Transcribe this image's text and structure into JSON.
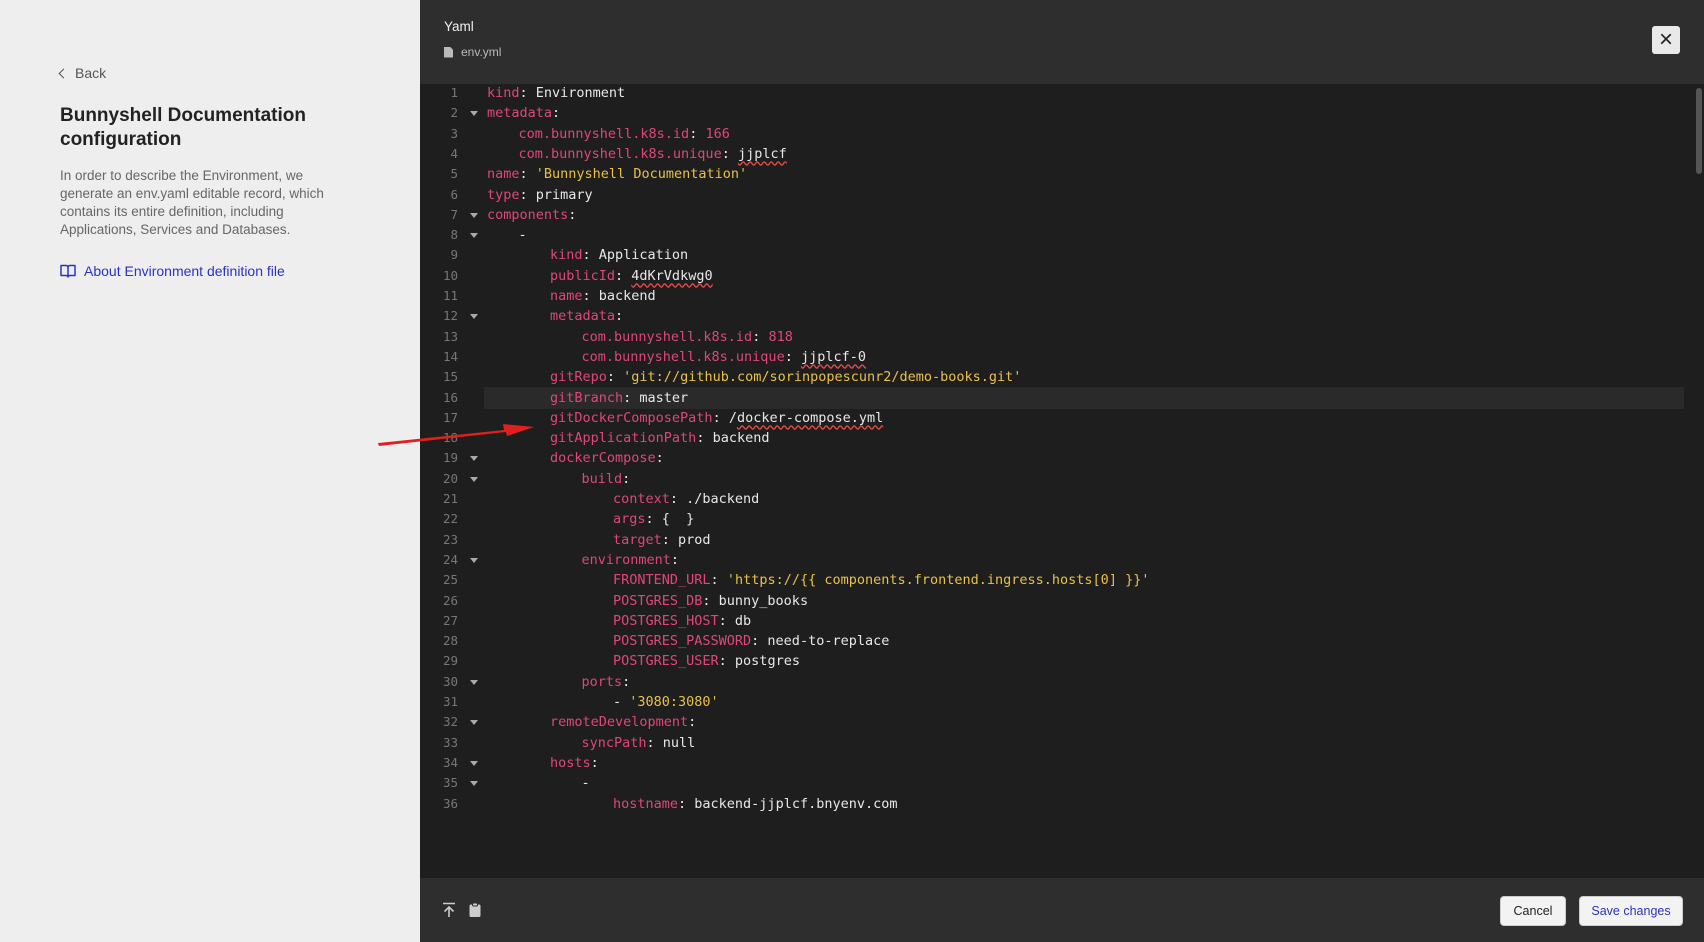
{
  "sidebar": {
    "back_label": "Back",
    "title": "Bunnyshell Documentation configuration",
    "description": "In order to describe the Environment, we generate an env.yaml editable record, which contains its entire definition, including Applications, Services and Databases.",
    "about_link": "About Environment definition file"
  },
  "modal": {
    "title": "Yaml",
    "filename": "env.yml",
    "close_icon": "close-icon"
  },
  "editor": {
    "active_line": 16,
    "lines": [
      {
        "n": "1",
        "indent": 0,
        "fold": false,
        "segs": [
          {
            "t": "kind",
            "c": "k"
          },
          {
            "t": ": Environment",
            "c": "p"
          }
        ]
      },
      {
        "n": "2",
        "indent": 0,
        "fold": true,
        "segs": [
          {
            "t": "metadata",
            "c": "k"
          },
          {
            "t": ":",
            "c": "p"
          }
        ]
      },
      {
        "n": "3",
        "indent": 1,
        "fold": false,
        "segs": [
          {
            "t": "com.bunnyshell.k8s.id",
            "c": "k"
          },
          {
            "t": ": ",
            "c": "p"
          },
          {
            "t": "166",
            "c": "n"
          }
        ]
      },
      {
        "n": "4",
        "indent": 1,
        "fold": false,
        "segs": [
          {
            "t": "com.bunnyshell.k8s.unique",
            "c": "k"
          },
          {
            "t": ": ",
            "c": "p"
          },
          {
            "t": "jjplcf",
            "c": "p",
            "sq": true
          }
        ]
      },
      {
        "n": "5",
        "indent": 0,
        "fold": false,
        "segs": [
          {
            "t": "name",
            "c": "k"
          },
          {
            "t": ": ",
            "c": "p"
          },
          {
            "t": "'Bunnyshell Documentation'",
            "c": "s"
          }
        ]
      },
      {
        "n": "6",
        "indent": 0,
        "fold": false,
        "segs": [
          {
            "t": "type",
            "c": "k"
          },
          {
            "t": ": primary",
            "c": "p"
          }
        ]
      },
      {
        "n": "7",
        "indent": 0,
        "fold": true,
        "segs": [
          {
            "t": "components",
            "c": "k"
          },
          {
            "t": ":",
            "c": "p"
          }
        ]
      },
      {
        "n": "8",
        "indent": 1,
        "fold": true,
        "segs": [
          {
            "t": "-",
            "c": "p"
          }
        ]
      },
      {
        "n": "9",
        "indent": 2,
        "fold": false,
        "segs": [
          {
            "t": "kind",
            "c": "k"
          },
          {
            "t": ": Application",
            "c": "p"
          }
        ]
      },
      {
        "n": "10",
        "indent": 2,
        "fold": false,
        "segs": [
          {
            "t": "publicId",
            "c": "k"
          },
          {
            "t": ": ",
            "c": "p"
          },
          {
            "t": "4dKrVdkwg0",
            "c": "p",
            "sq": true
          }
        ]
      },
      {
        "n": "11",
        "indent": 2,
        "fold": false,
        "segs": [
          {
            "t": "name",
            "c": "k"
          },
          {
            "t": ": backend",
            "c": "p"
          }
        ]
      },
      {
        "n": "12",
        "indent": 2,
        "fold": true,
        "segs": [
          {
            "t": "metadata",
            "c": "k"
          },
          {
            "t": ":",
            "c": "p"
          }
        ]
      },
      {
        "n": "13",
        "indent": 3,
        "fold": false,
        "segs": [
          {
            "t": "com.bunnyshell.k8s.id",
            "c": "k"
          },
          {
            "t": ": ",
            "c": "p"
          },
          {
            "t": "818",
            "c": "n"
          }
        ]
      },
      {
        "n": "14",
        "indent": 3,
        "fold": false,
        "segs": [
          {
            "t": "com.bunnyshell.k8s.unique",
            "c": "k"
          },
          {
            "t": ": ",
            "c": "p"
          },
          {
            "t": "jjplcf-0",
            "c": "p",
            "sq": true
          }
        ]
      },
      {
        "n": "15",
        "indent": 2,
        "fold": false,
        "segs": [
          {
            "t": "gitRepo",
            "c": "k"
          },
          {
            "t": ": ",
            "c": "p"
          },
          {
            "t": "'git://github.com/sorinpopescunr2/demo-books.git'",
            "c": "s"
          }
        ]
      },
      {
        "n": "16",
        "indent": 2,
        "fold": false,
        "segs": [
          {
            "t": "gitBranch",
            "c": "k"
          },
          {
            "t": ": master",
            "c": "p"
          }
        ]
      },
      {
        "n": "17",
        "indent": 2,
        "fold": false,
        "segs": [
          {
            "t": "gitDockerComposePath",
            "c": "k"
          },
          {
            "t": ": /",
            "c": "p"
          },
          {
            "t": "docker-compose.yml",
            "c": "p",
            "sq": true
          }
        ]
      },
      {
        "n": "18",
        "indent": 2,
        "fold": false,
        "segs": [
          {
            "t": "gitApplicationPath",
            "c": "k"
          },
          {
            "t": ": backend",
            "c": "p"
          }
        ]
      },
      {
        "n": "19",
        "indent": 2,
        "fold": true,
        "segs": [
          {
            "t": "dockerCompose",
            "c": "k"
          },
          {
            "t": ":",
            "c": "p"
          }
        ]
      },
      {
        "n": "20",
        "indent": 3,
        "fold": true,
        "segs": [
          {
            "t": "build",
            "c": "k"
          },
          {
            "t": ":",
            "c": "p"
          }
        ]
      },
      {
        "n": "21",
        "indent": 4,
        "fold": false,
        "segs": [
          {
            "t": "context",
            "c": "k"
          },
          {
            "t": ": ./backend",
            "c": "p"
          }
        ]
      },
      {
        "n": "22",
        "indent": 4,
        "fold": false,
        "segs": [
          {
            "t": "args",
            "c": "k"
          },
          {
            "t": ": {  }",
            "c": "p"
          }
        ]
      },
      {
        "n": "23",
        "indent": 4,
        "fold": false,
        "segs": [
          {
            "t": "target",
            "c": "k"
          },
          {
            "t": ": prod",
            "c": "p"
          }
        ]
      },
      {
        "n": "24",
        "indent": 3,
        "fold": true,
        "segs": [
          {
            "t": "environment",
            "c": "k"
          },
          {
            "t": ":",
            "c": "p"
          }
        ]
      },
      {
        "n": "25",
        "indent": 4,
        "fold": false,
        "segs": [
          {
            "t": "FRONTEND_URL",
            "c": "k"
          },
          {
            "t": ": ",
            "c": "p"
          },
          {
            "t": "'https://{{ components.frontend.ingress.hosts[0] }}'",
            "c": "s"
          }
        ]
      },
      {
        "n": "26",
        "indent": 4,
        "fold": false,
        "segs": [
          {
            "t": "POSTGRES_DB",
            "c": "k"
          },
          {
            "t": ": bunny_books",
            "c": "p"
          }
        ]
      },
      {
        "n": "27",
        "indent": 4,
        "fold": false,
        "segs": [
          {
            "t": "POSTGRES_HOST",
            "c": "k"
          },
          {
            "t": ": db",
            "c": "p"
          }
        ]
      },
      {
        "n": "28",
        "indent": 4,
        "fold": false,
        "segs": [
          {
            "t": "POSTGRES_PASSWORD",
            "c": "k"
          },
          {
            "t": ": need-to-replace",
            "c": "p"
          }
        ]
      },
      {
        "n": "29",
        "indent": 4,
        "fold": false,
        "segs": [
          {
            "t": "POSTGRES_USER",
            "c": "k"
          },
          {
            "t": ": postgres",
            "c": "p"
          }
        ]
      },
      {
        "n": "30",
        "indent": 3,
        "fold": true,
        "segs": [
          {
            "t": "ports",
            "c": "k"
          },
          {
            "t": ":",
            "c": "p"
          }
        ]
      },
      {
        "n": "31",
        "indent": 4,
        "fold": false,
        "segs": [
          {
            "t": "- ",
            "c": "p"
          },
          {
            "t": "'3080:3080'",
            "c": "s"
          }
        ]
      },
      {
        "n": "32",
        "indent": 2,
        "fold": true,
        "segs": [
          {
            "t": "remoteDevelopment",
            "c": "k"
          },
          {
            "t": ":",
            "c": "p"
          }
        ]
      },
      {
        "n": "33",
        "indent": 3,
        "fold": false,
        "segs": [
          {
            "t": "syncPath",
            "c": "k"
          },
          {
            "t": ": null",
            "c": "p"
          }
        ]
      },
      {
        "n": "34",
        "indent": 2,
        "fold": true,
        "segs": [
          {
            "t": "hosts",
            "c": "k"
          },
          {
            "t": ":",
            "c": "p"
          }
        ]
      },
      {
        "n": "35",
        "indent": 3,
        "fold": true,
        "segs": [
          {
            "t": "-",
            "c": "p"
          }
        ]
      },
      {
        "n": "36",
        "indent": 4,
        "fold": false,
        "segs": [
          {
            "t": "hostname",
            "c": "k"
          },
          {
            "t": ": backend-jjplcf.bnyenv.com",
            "c": "p"
          }
        ]
      }
    ]
  },
  "footer": {
    "cancel_label": "Cancel",
    "save_label": "Save changes"
  },
  "colors": {
    "key": "#e0467c",
    "string": "#e9c04a",
    "link": "#2933c4",
    "annotation_arrow": "#e02020"
  }
}
